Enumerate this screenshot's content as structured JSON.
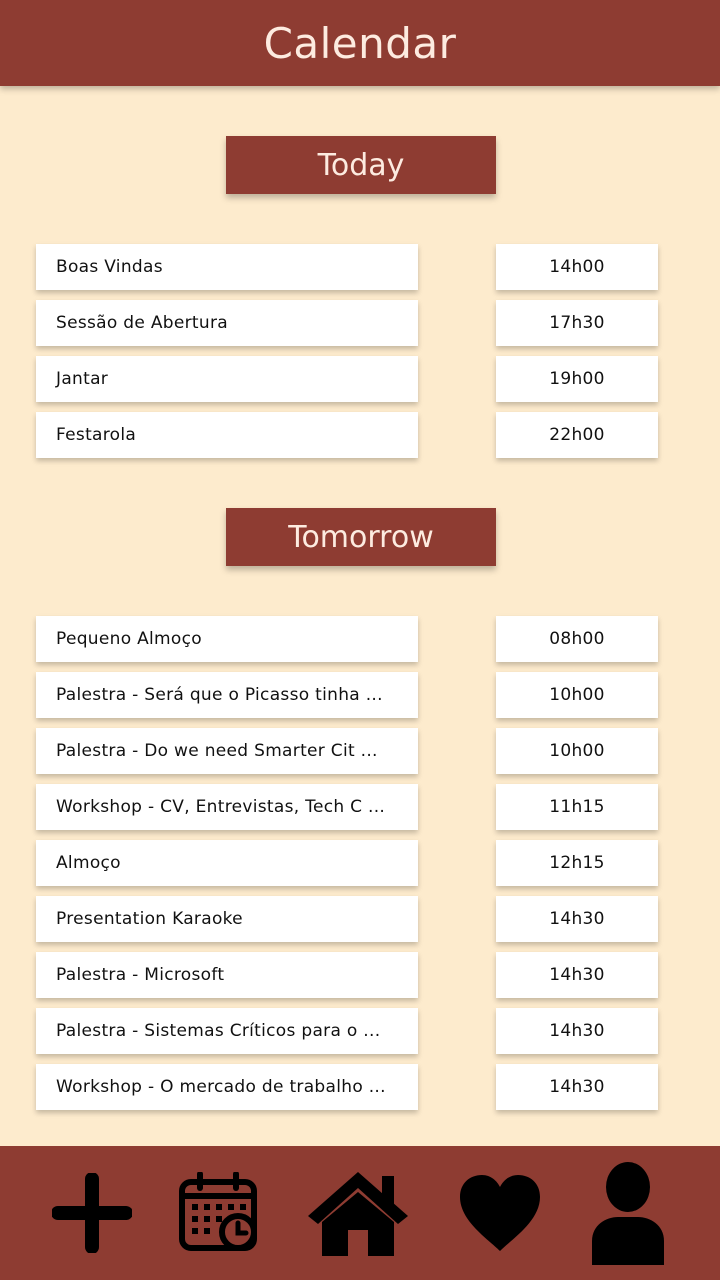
{
  "header": {
    "title": "Calendar"
  },
  "sections": {
    "today": {
      "title": "Today",
      "events": [
        {
          "name": "Boas Vindas",
          "time": "14h00"
        },
        {
          "name": "Sessão de Abertura",
          "time": "17h30"
        },
        {
          "name": "Jantar",
          "time": "19h00"
        },
        {
          "name": "Festarola",
          "time": "22h00"
        }
      ]
    },
    "tomorrow": {
      "title": "Tomorrow",
      "events": [
        {
          "name": "Pequeno Almoço",
          "time": "08h00"
        },
        {
          "name": "Palestra - Será que o Picasso tinha ...",
          "time": "10h00"
        },
        {
          "name": "Palestra - Do we need Smarter Cit ...",
          "time": "10h00"
        },
        {
          "name": "Workshop - CV, Entrevistas, Tech C ...",
          "time": "11h15"
        },
        {
          "name": "Almoço",
          "time": "12h15"
        },
        {
          "name": "Presentation Karaoke",
          "time": "14h30"
        },
        {
          "name": "Palestra - Microsoft",
          "time": "14h30"
        },
        {
          "name": "Palestra - Sistemas Críticos para o ...",
          "time": "14h30"
        },
        {
          "name": "Workshop - O mercado de trabalho ...",
          "time": "14h30"
        }
      ]
    }
  },
  "bottom_nav": {
    "items": [
      {
        "icon": "plus-icon"
      },
      {
        "icon": "calendar-clock-icon"
      },
      {
        "icon": "home-icon"
      },
      {
        "icon": "heart-icon"
      },
      {
        "icon": "user-icon"
      }
    ]
  },
  "colors": {
    "brand": "#8e3c32",
    "background": "#fdebcd",
    "card": "#ffffff",
    "header_text": "#fdebe0"
  }
}
